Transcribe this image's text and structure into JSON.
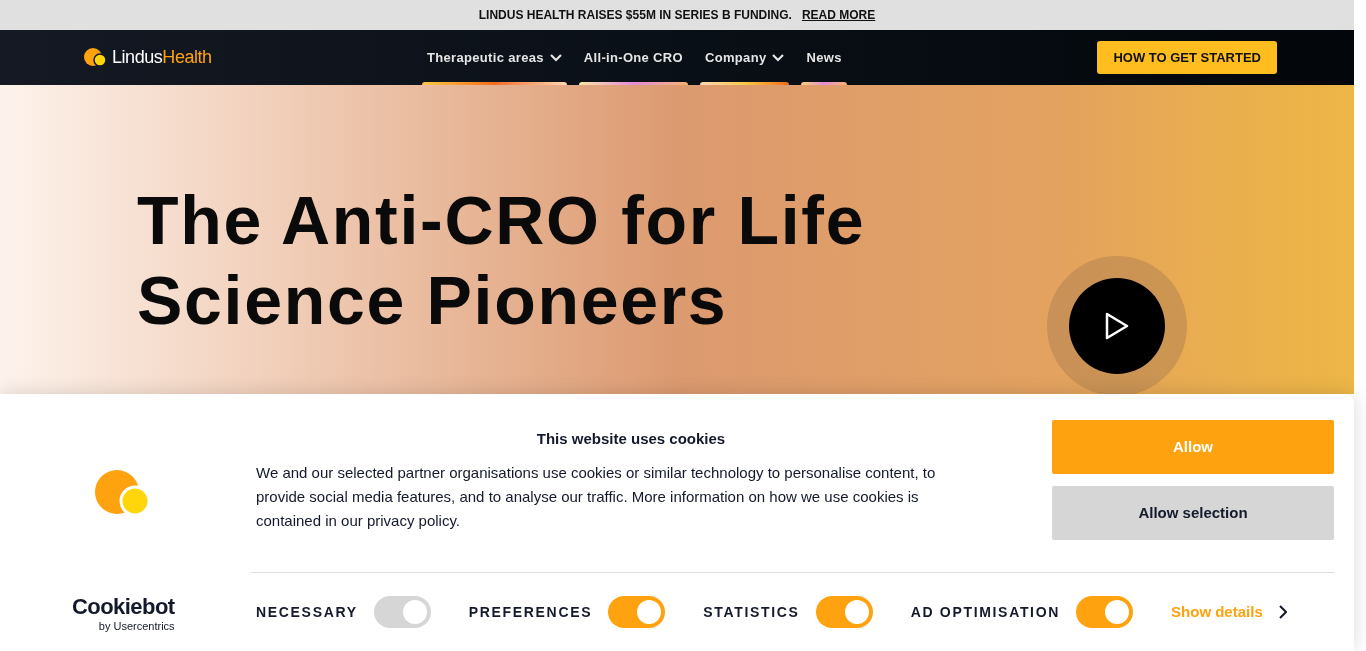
{
  "announcement": {
    "text": "LINDUS HEALTH RAISES $55M IN SERIES B FUNDING.",
    "link": "READ MORE"
  },
  "nav": {
    "logo": {
      "first": "Lindus",
      "second": "Health"
    },
    "items": [
      {
        "label": "Therapeutic areas",
        "dropdown": true
      },
      {
        "label": "All-in-One CRO",
        "dropdown": false
      },
      {
        "label": "Company",
        "dropdown": true
      },
      {
        "label": "News",
        "dropdown": false
      }
    ],
    "cta": "HOW TO GET STARTED"
  },
  "hero": {
    "title": "The Anti-CRO for Life Science Pioneers"
  },
  "cookie_banner": {
    "title": "This website uses cookies",
    "body": "We and our selected partner organisations use cookies or similar technology to personalise content, to provide social media features, and to analyse our traffic. More information on how we use cookies is contained in our privacy policy.",
    "buttons": [
      {
        "label": "Allow",
        "kind": "primary"
      },
      {
        "label": "Allow selection",
        "kind": "secondary"
      }
    ],
    "brand": {
      "name": "Cookiebot",
      "tagline": "by Usercentrics"
    },
    "toggles": [
      {
        "label": "NECESSARY",
        "on": true,
        "disabled": true
      },
      {
        "label": "PREFERENCES",
        "on": true,
        "disabled": false
      },
      {
        "label": "STATISTICS",
        "on": true,
        "disabled": false
      },
      {
        "label": "AD OPTIMISATION",
        "on": true,
        "disabled": false
      }
    ],
    "details_link": "Show details"
  }
}
